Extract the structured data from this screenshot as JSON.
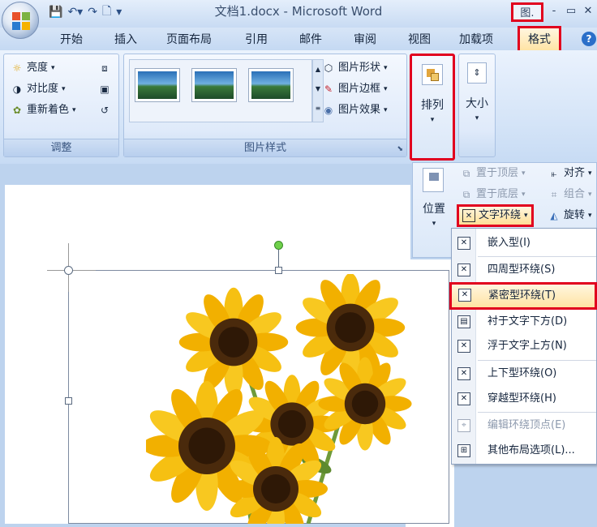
{
  "window": {
    "title": "文档1.docx - Microsoft Word",
    "contextual_tab": "图.",
    "minimize": "-",
    "restore": "▭",
    "close": "✕"
  },
  "tabs": [
    {
      "label": "开始"
    },
    {
      "label": "插入"
    },
    {
      "label": "页面布局"
    },
    {
      "label": "引用"
    },
    {
      "label": "邮件"
    },
    {
      "label": "审阅"
    },
    {
      "label": "视图"
    },
    {
      "label": "加载项"
    },
    {
      "label": "格式"
    }
  ],
  "ribbon": {
    "adjust": {
      "label": "调整",
      "brightness": "亮度",
      "contrast": "对比度",
      "recolor": "重新着色"
    },
    "styles": {
      "label": "图片样式",
      "shape": "图片形状",
      "border": "图片边框",
      "effects": "图片效果"
    },
    "arrange": {
      "label": "排列"
    },
    "size": {
      "label": "大小"
    }
  },
  "arrange_panel": {
    "position": "位置",
    "bring_front": "置于顶层",
    "send_back": "置于底层",
    "align": "对齐",
    "group": "组合",
    "text_wrap": "文字环绕",
    "rotate": "旋转"
  },
  "wrap_menu": {
    "items": [
      {
        "label": "嵌入型(I)"
      },
      {
        "label": "四周型环绕(S)"
      },
      {
        "label": "紧密型环绕(T)"
      },
      {
        "label": "衬于文字下方(D)"
      },
      {
        "label": "浮于文字上方(N)"
      },
      {
        "label": "上下型环绕(O)"
      },
      {
        "label": "穿越型环绕(H)"
      },
      {
        "label": "编辑环绕顶点(E)"
      },
      {
        "label": "其他布局选项(L)..."
      }
    ]
  },
  "colors": {
    "highlight": "#e1001e",
    "hover": "#ffe3a3"
  }
}
